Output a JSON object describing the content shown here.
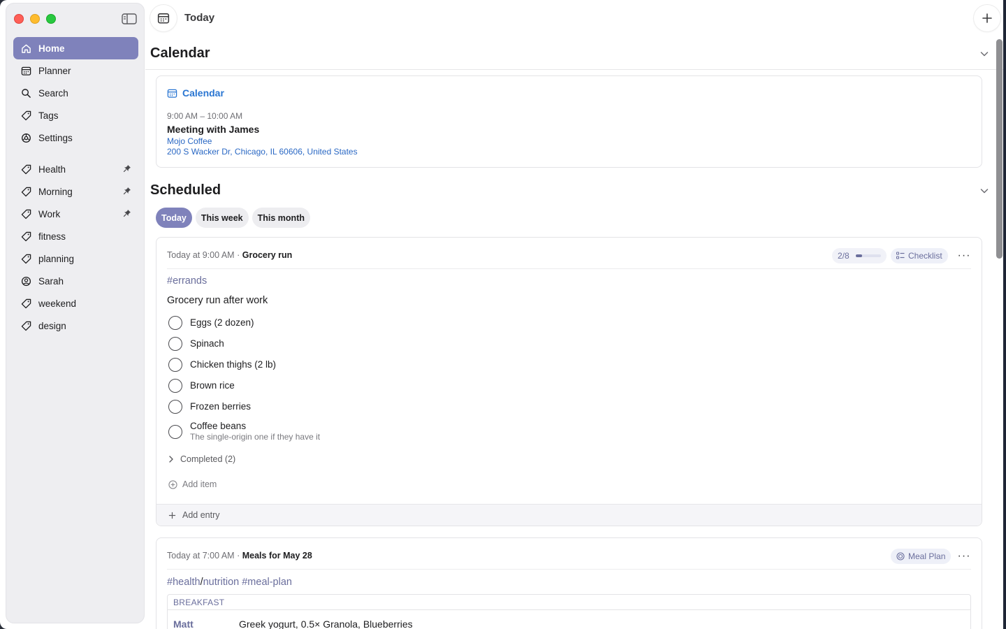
{
  "window": {
    "title": "Today"
  },
  "sidebar": {
    "items": [
      {
        "label": "Home",
        "icon": "home-icon",
        "active": true
      },
      {
        "label": "Planner",
        "icon": "planner-icon"
      },
      {
        "label": "Search",
        "icon": "search-icon"
      },
      {
        "label": "Tags",
        "icon": "tag-icon"
      },
      {
        "label": "Settings",
        "icon": "gear-icon"
      }
    ],
    "tags": [
      {
        "label": "Health",
        "icon": "tag-icon",
        "pinned": true
      },
      {
        "label": "Morning",
        "icon": "tag-icon",
        "pinned": true
      },
      {
        "label": "Work",
        "icon": "tag-icon",
        "pinned": true
      },
      {
        "label": "fitness",
        "icon": "tag-icon"
      },
      {
        "label": "planning",
        "icon": "tag-icon"
      },
      {
        "label": "Sarah",
        "icon": "person-icon"
      },
      {
        "label": "weekend",
        "icon": "tag-icon"
      },
      {
        "label": "design",
        "icon": "tag-icon"
      }
    ]
  },
  "calendar": {
    "section_title": "Calendar",
    "card_title": "Calendar",
    "time": "9:00 AM – 10:00 AM",
    "event_title": "Meeting with James",
    "location_name": "Mojo Coffee",
    "address": "200 S Wacker Dr, Chicago, IL  60606, United States"
  },
  "scheduled": {
    "section_title": "Scheduled",
    "tabs": [
      "Today",
      "This week",
      "This month"
    ],
    "active_tab": "Today"
  },
  "entry1": {
    "time": "Today at 9:00 AM",
    "separator": "·",
    "title": "Grocery run",
    "progress_text": "2/8",
    "progress_fraction": 0.25,
    "type_label": "Checklist",
    "more": "···",
    "tag": "#errands",
    "description": "Grocery run after work",
    "items": [
      {
        "text": "Eggs (2 dozen)"
      },
      {
        "text": "Spinach"
      },
      {
        "text": "Chicken thighs (2 lb)"
      },
      {
        "text": "Brown rice"
      },
      {
        "text": "Frozen berries"
      },
      {
        "text": "Coffee beans",
        "note": "The single-origin one if they have it"
      }
    ],
    "completed_label": "Completed (2)",
    "add_item_label": "Add item",
    "add_entry_label": "Add entry"
  },
  "entry2": {
    "time": "Today at 7:00 AM",
    "separator": "·",
    "title": "Meals for May 28",
    "type_label": "Meal Plan",
    "more": "···",
    "tag_a": "#health",
    "tag_slash": "/",
    "tag_b": "nutrition",
    "tag_c": "#meal-plan",
    "table_header": "BREAKFAST",
    "row_name": "Matt",
    "row_value": "Greek yogurt, 0.5× Granola, Blueberries"
  },
  "colors": {
    "accent": "#7f82bb",
    "link": "#2a68c4",
    "tag": "#6a6e9c"
  }
}
